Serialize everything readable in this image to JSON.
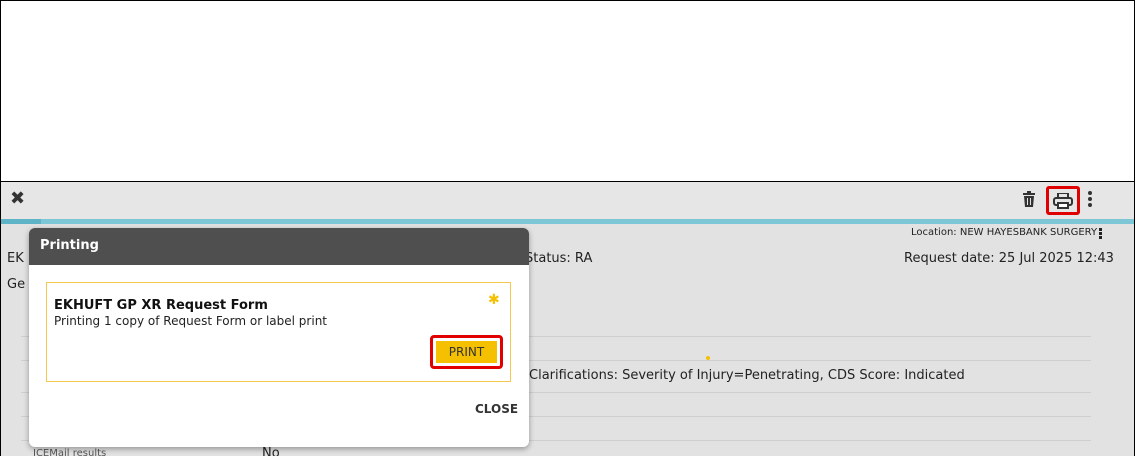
{
  "toolbar": {
    "close_icon": "close-icon",
    "delete_icon": "trash-icon",
    "print_icon": "printer-icon",
    "more_icon": "more-vertical-icon"
  },
  "header": {
    "location_label": "Location: NEW HAYESBANK SURGERY",
    "request_date": "Request date: 25 Jul 2025 12:43",
    "status": "Status: RA",
    "left_fragment_1": "EK",
    "left_fragment_2": "Ge"
  },
  "rows": {
    "clarifications": "Clarifications: Severity of Injury=Penetrating, CDS Score: Indicated",
    "icemail_label": "ICEMail results",
    "icemail_value": "No"
  },
  "dialog": {
    "title": "Printing",
    "form_title": "EKHUFT GP XR Request Form",
    "form_description": "Printing 1 copy of Request Form or label print",
    "print_label": "PRINT",
    "close_label": "CLOSE",
    "star_icon": "star-icon"
  },
  "colors": {
    "accent_yellow": "#f5c000",
    "highlight_red": "#e00000",
    "dialog_header": "#4f4f4f",
    "cyan_bar": "#7cc6d6"
  }
}
